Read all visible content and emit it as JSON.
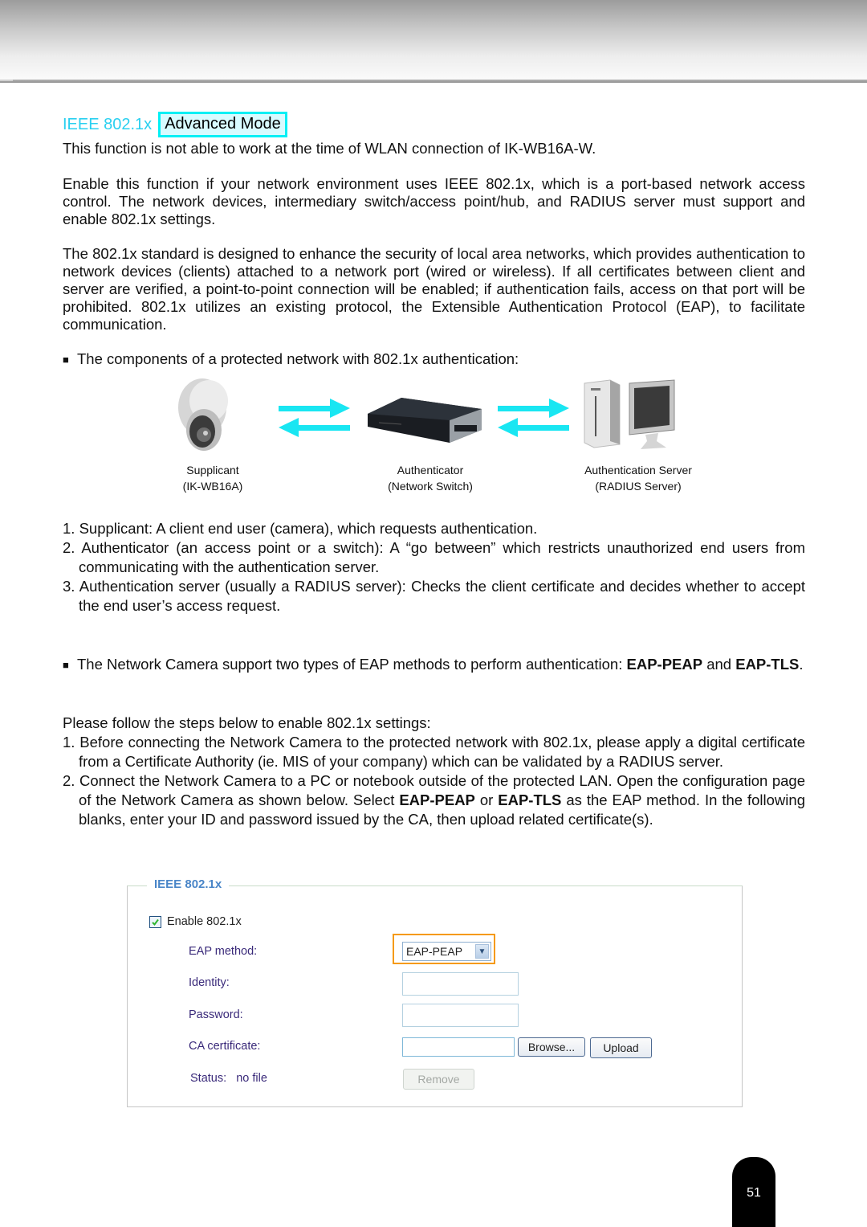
{
  "header": {
    "section_title": "IEEE 802.1x",
    "mode_badge": "Advanced Mode"
  },
  "paragraphs": {
    "note": "This function is not able to work at the time of WLAN connection of IK-WB16A-W.",
    "enable": "Enable this function if your network environment uses IEEE 802.1x, which is a port-based network access control. The network devices, intermediary switch/access point/hub, and RADIUS server must support and enable 802.1x settings.",
    "standard": "The 802.1x standard is designed to enhance the security of local area networks, which provides authentication to network devices (clients) attached to a network port (wired or wireless). If all certificates between client and server are verified, a point-to-point connection will be enabled; if authentication fails, access on that port will be prohibited. 802.1x utilizes an existing protocol, the Extensible Authentication Protocol (EAP), to facilitate communication.",
    "components_bullet": "■",
    "components": "The components of a protected network with 802.1x authentication:"
  },
  "diagram": {
    "nodes": [
      {
        "icon": "dome-camera-icon",
        "label": "Supplicant",
        "sublabel": "(IK-WB16A)"
      },
      {
        "icon": "network-switch-icon",
        "label": "Authenticator",
        "sublabel": "(Network Switch)"
      },
      {
        "icon": "radius-server-icon",
        "label": "Authentication Server",
        "sublabel": "(RADIUS Server)"
      }
    ],
    "arrow_color": "#19e6f2"
  },
  "component_list": [
    {
      "num": "1.",
      "text": "Supplicant: A client end user (camera), which requests authentication."
    },
    {
      "num": "2.",
      "text": "Authenticator (an access point or a switch): A “go between” which restricts unauthorized end users from communicating with the authentication server."
    },
    {
      "num": "3.",
      "text": "Authentication server (usually a RADIUS server): Checks the client certificate and decides whether to accept the end user’s access request."
    }
  ],
  "eap_methods": {
    "bullet": "■",
    "text_before": "The Network Camera support two types of EAP methods to perform authentication: ",
    "method1": "EAP-PEAP",
    "text_mid": " and ",
    "method2": "EAP-TLS",
    "text_after": "."
  },
  "steps": {
    "intro": "Please follow the steps below to enable 802.1x settings:",
    "step1_num": "1.",
    "step1": "Before connecting the Network Camera to the protected network with 802.1x, please apply a digital certificate from a Certificate Authority (ie. MIS of your company) which can be validated by a RADIUS server.",
    "step2_num": "2.",
    "step2_a": "Connect the Network Camera to a PC or notebook outside of the protected LAN. Open the configuration page of the Network Camera as shown below. Select ",
    "step2_b": "EAP-PEAP",
    "step2_c": " or ",
    "step2_d": "EAP-TLS",
    "step2_e": " as the EAP method. In the following blanks, enter your ID and password issued by the CA, then upload related certificate(s)."
  },
  "settings_panel": {
    "legend": "IEEE 802.1x",
    "enable_label": "Enable 802.1x",
    "enable_checked": true,
    "eap_method_label": "EAP method:",
    "eap_method_value": "EAP-PEAP",
    "identity_label": "Identity:",
    "identity_value": "",
    "password_label": "Password:",
    "password_value": "",
    "ca_cert_label": "CA certificate:",
    "ca_cert_value": "",
    "browse_button": "Browse...",
    "upload_button": "Upload",
    "status_label": "Status:",
    "status_value": "no file",
    "remove_button": "Remove",
    "highlight_color": "#f59a12"
  },
  "footer": {
    "page_number": "51"
  }
}
